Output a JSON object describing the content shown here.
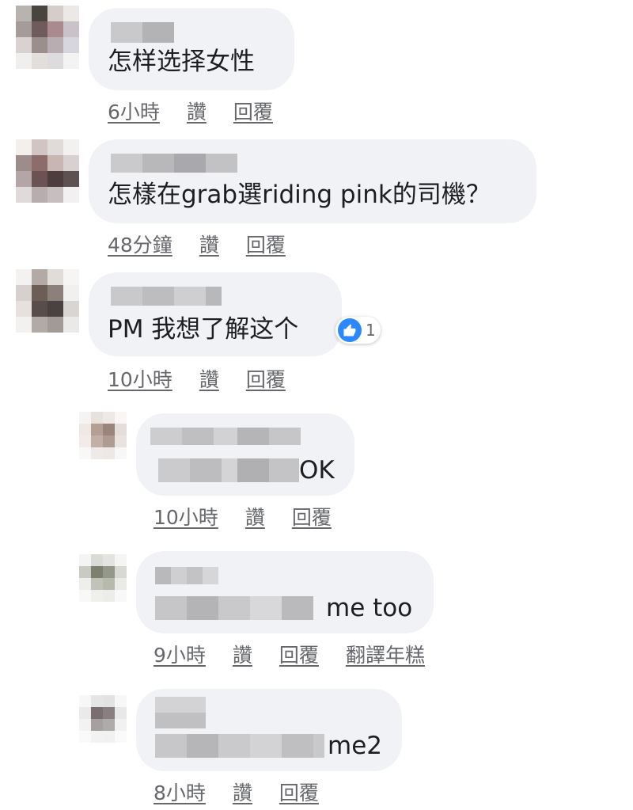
{
  "comments": [
    {
      "text": "怎样选择女性",
      "actions": [
        "6小時",
        "讚",
        "回覆"
      ]
    },
    {
      "text": "怎樣在grab選riding pink的司機？",
      "actions": [
        "48分鐘",
        "讚",
        "回覆"
      ]
    },
    {
      "text": "PM 我想了解这个",
      "actions": [
        "10小時",
        "讚",
        "回覆"
      ],
      "reaction": {
        "icon": "like-icon",
        "count": "1",
        "color": "#2d88ff"
      }
    },
    {
      "text": "OK",
      "actions": [
        "10小時",
        "讚",
        "回覆"
      ]
    },
    {
      "text": "me too",
      "actions": [
        "9小時",
        "讚",
        "回覆",
        "翻譯年糕"
      ]
    },
    {
      "text": "me2",
      "actions": [
        "8小時",
        "讚",
        "回覆"
      ]
    }
  ],
  "colors": {
    "bubble": "#f0f2f5",
    "action_text": "#65676b",
    "text": "#1c1e21",
    "like": "#2d88ff"
  }
}
